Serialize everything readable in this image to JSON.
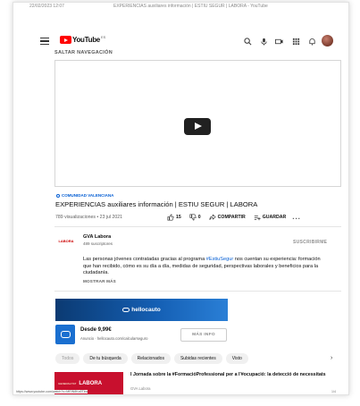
{
  "tab": {
    "left_text": "22/02/2023 12:07",
    "center_text": "EXPERIENCIAS auxiliares información | ESTIU SEGUR | LABORA - YouTube"
  },
  "header": {
    "logo_text": "YouTube",
    "country": "ES"
  },
  "skip_navigation": "SALTAR NAVEGACIÓN",
  "video": {
    "channel_tag": "COMUNIDAD VALENCIANA",
    "title": "EXPERIENCIAS auxiliares información | ESTIU SEGUR | LABORA",
    "views_date": "789 visualizaciones • 23 jul 2021",
    "likes": "15",
    "dislikes": "0",
    "share_label": "COMPARTIR",
    "save_label": "GUARDAR",
    "more": "..."
  },
  "channel": {
    "logo_text": "LABORA",
    "name": "GVA Labora",
    "subscribers": "489 suscriptores",
    "subscribe_label": "SUSCRIBIRME"
  },
  "description": {
    "part1": "Las personas jóvenes contratadas gracias al programa ",
    "hashtag": "#EstiuSegur",
    "part2": " nos cuentan su experiencia: formación que han recibido, cómo es su día a día, medidas de seguridad, perspectivas laborales y beneficios para la ciudadanía.",
    "show_more": "MOSTRAR MÁS"
  },
  "ad": {
    "banner_text": "hellocauto",
    "price": "Desde 9,99€",
    "url": "Anuncio · hellocauto.com/calcularseguro",
    "button": "MÁS INFO"
  },
  "chips": [
    "Todos",
    "De tu búsqueda",
    "Relacionados",
    "Subidas recientes",
    "Visto"
  ],
  "chip_arrow": "›",
  "recommended": {
    "thumb_small": "GENERALITAT",
    "thumb_text": "LABORA",
    "title": "I Jornada sobre la #FormacióProfessional per a l'#ocupació: la detecció de necessitats",
    "channel": "GVA Labora"
  },
  "status": {
    "url": "https://www.youtube.com/watch?v=MEIN8Ka5Tkw",
    "page": "1/4"
  }
}
